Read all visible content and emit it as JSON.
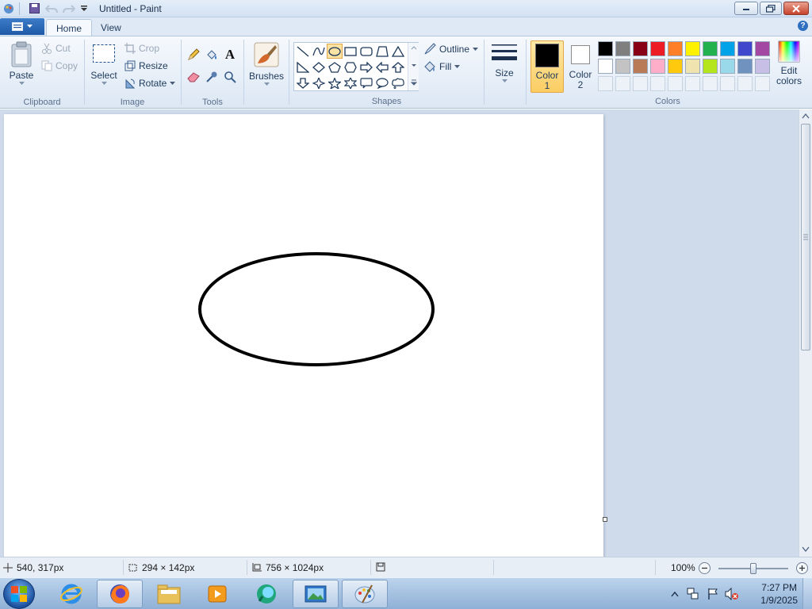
{
  "window": {
    "title": "Untitled - Paint"
  },
  "tabs": [
    {
      "label": "Home"
    },
    {
      "label": "View"
    }
  ],
  "clipboard": {
    "paste": "Paste",
    "cut": "Cut",
    "copy": "Copy",
    "group": "Clipboard"
  },
  "image": {
    "select": "Select",
    "crop": "Crop",
    "resize": "Resize",
    "rotate": "Rotate",
    "group": "Image"
  },
  "tools": {
    "group": "Tools"
  },
  "brushes": {
    "label": "Brushes"
  },
  "shapes": {
    "outline": "Outline",
    "fill": "Fill",
    "group": "Shapes"
  },
  "size": {
    "label": "Size"
  },
  "colors": {
    "color1": {
      "label": "Color",
      "number": "1",
      "value": "#000000"
    },
    "color2": {
      "label": "Color",
      "number": "2",
      "value": "#ffffff"
    },
    "edit": {
      "label": "Edit",
      "label2": "colors"
    },
    "group": "Colors",
    "palette_row1": [
      "#000000",
      "#7f7f7f",
      "#880015",
      "#ed1c24",
      "#ff7f27",
      "#fff200",
      "#22b14c",
      "#00a2e8",
      "#3f48cc",
      "#a349a4"
    ],
    "palette_row2": [
      "#ffffff",
      "#c3c3c3",
      "#b97a57",
      "#ffaec9",
      "#ffc90e",
      "#efe4b0",
      "#b5e61d",
      "#99d9ea",
      "#7092be",
      "#c8bfe7"
    ]
  },
  "status": {
    "cursor_pos": "540, 317px",
    "selection_size": "294 × 142px",
    "canvas_size": "756 × 1024px",
    "zoom": "100%",
    "zoom_fraction": 0.5
  },
  "taskbar": {
    "time": "7:27 PM",
    "date": "1/9/2025"
  },
  "canvas": {
    "drawn_shape": "ellipse",
    "stroke_color": "#000000"
  }
}
